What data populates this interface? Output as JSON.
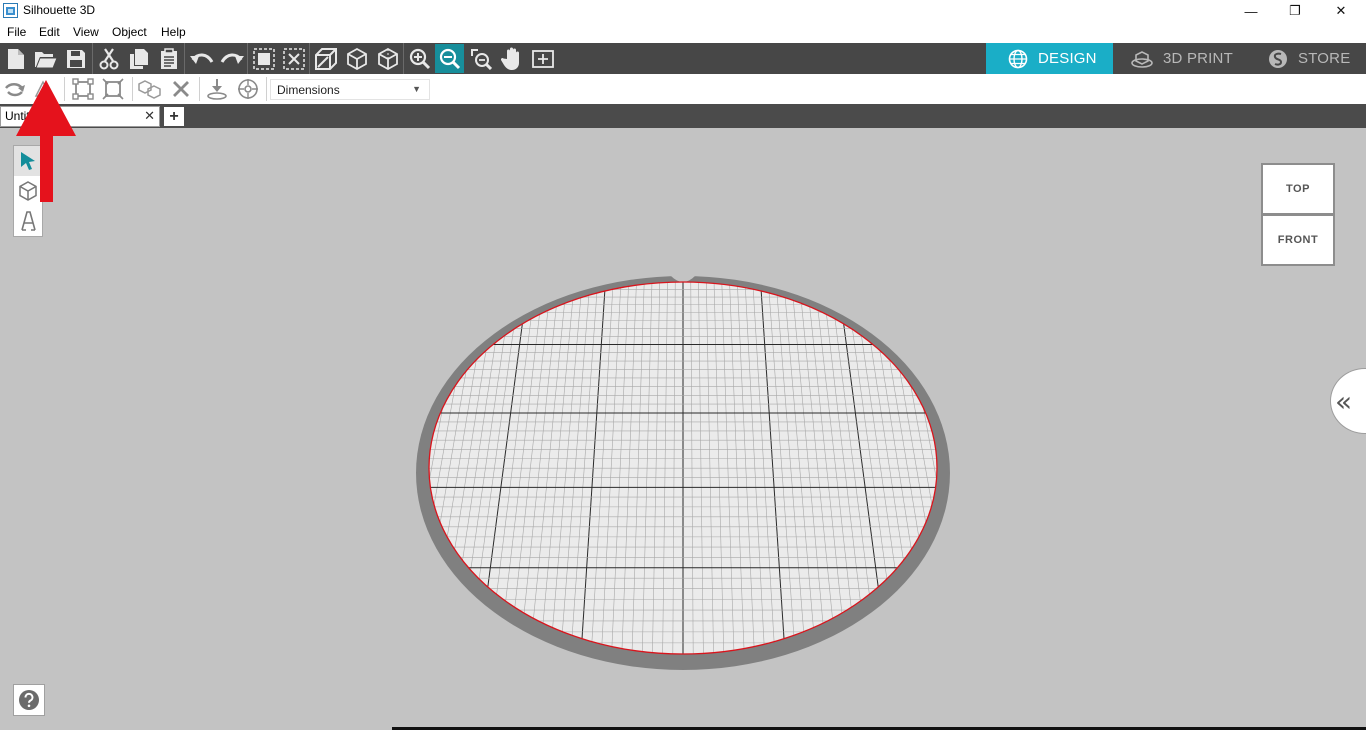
{
  "window": {
    "title": "Silhouette 3D",
    "controls": {
      "minimize": "—",
      "restore": "❐",
      "close": "✕"
    }
  },
  "menu": {
    "items": [
      "File",
      "Edit",
      "View",
      "Object",
      "Help"
    ]
  },
  "toolbar": {
    "tools": [
      "new-file",
      "open-file",
      "save",
      "cut",
      "copy",
      "paste",
      "undo",
      "redo",
      "select-all",
      "deselect",
      "view-perspective",
      "view-cube-front",
      "view-cube-back",
      "zoom-in",
      "zoom-out",
      "zoom-fit",
      "pan-hand",
      "add-frame"
    ],
    "active_tool": "zoom-out"
  },
  "mode_tabs": [
    {
      "label": "DESIGN",
      "icon": "globe-icon",
      "active": true
    },
    {
      "label": "3D PRINT",
      "icon": "printer-3d-icon",
      "active": false
    },
    {
      "label": "STORE",
      "icon": "silhouette-s-icon",
      "active": false
    }
  ],
  "toolbar2": {
    "tools": [
      "rotate",
      "flip",
      "scale",
      "group",
      "ungroup",
      "delete",
      "drop-to-bed",
      "center-on-bed"
    ],
    "dimensions_select": {
      "value": "Dimensions"
    }
  },
  "document_tabs": [
    {
      "label": "Untitled"
    }
  ],
  "side_tools": [
    "select-arrow",
    "3d-cube",
    "text-tool"
  ],
  "view_cube": {
    "top": "TOP",
    "front": "FRONT"
  },
  "colors": {
    "toolbar_bg": "#474747",
    "accent_active": "#1aaec7",
    "canvas_bg": "#c3c3c3",
    "bed_ring": "#808080",
    "bed_surface": "#ebebeb",
    "bed_edge": "#d9141c",
    "annotation_arrow": "#e5121c"
  }
}
